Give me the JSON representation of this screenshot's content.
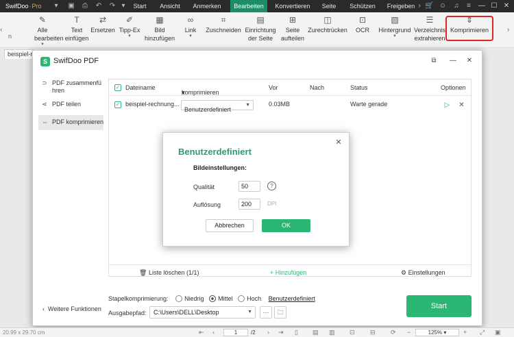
{
  "app": {
    "logo_name": "SwifDoo",
    "logo_pro": "Pro",
    "accent_color": "#2bb673",
    "menu_active_color": "#1e8c67"
  },
  "menu": {
    "tabs": [
      "Start",
      "Ansicht",
      "Anmerken",
      "Bearbeiten",
      "Konvertieren",
      "Seite",
      "Schützen",
      "Freigeben"
    ],
    "active_tab": "Bearbeiten"
  },
  "ribbon": {
    "left_partial": "n",
    "items": [
      {
        "label1": "Alle",
        "label2": "bearbeiten",
        "icon": "edit-icon",
        "caret": true
      },
      {
        "label1": "Text",
        "label2": "einfügen",
        "icon": "text-icon",
        "caret": false
      },
      {
        "label1": "Ersetzen",
        "label2": "",
        "icon": "replace-icon",
        "caret": false
      },
      {
        "label1": "Tipp-Ex",
        "label2": "",
        "icon": "whiteout-icon",
        "caret": true
      },
      {
        "label1": "Bild",
        "label2": "hinzufügen",
        "icon": "image-icon",
        "caret": false
      },
      {
        "label1": "Link",
        "label2": "",
        "icon": "link-icon",
        "caret": true
      },
      {
        "label1": "Zuschneiden",
        "label2": "",
        "icon": "crop-icon",
        "caret": false
      },
      {
        "label1": "Einrichtung",
        "label2": "der Seite",
        "icon": "page-setup-icon",
        "caret": false
      },
      {
        "label1": "Seite",
        "label2": "aufteilen",
        "icon": "split-icon",
        "caret": false
      },
      {
        "label1": "Zurechtrücken",
        "label2": "",
        "icon": "deskew-icon",
        "caret": false
      },
      {
        "label1": "OCR",
        "label2": "",
        "icon": "ocr-icon",
        "caret": false
      },
      {
        "label1": "Hintergrund",
        "label2": "",
        "icon": "background-icon",
        "caret": true
      },
      {
        "label1": "Verzeichnis",
        "label2": "extrahieren",
        "icon": "toc-icon",
        "caret": false
      },
      {
        "label1": "Komprimieren",
        "label2": "",
        "icon": "compress-icon",
        "caret": false
      }
    ],
    "highlighted": "Komprimieren"
  },
  "document": {
    "tab_label": "beispiel-r"
  },
  "statusbar": {
    "dimensions": "20.99 x 29.70 cm",
    "page_current": "1",
    "page_total": "/2",
    "zoom": "125%"
  },
  "dialog": {
    "title": "SwifDoo PDF",
    "nav": [
      {
        "label": "PDF zusammenfü hren",
        "icon": "merge-icon",
        "active": false
      },
      {
        "label": "PDF teilen",
        "icon": "split-icon",
        "active": false
      },
      {
        "label": "PDF komprimieren",
        "icon": "compress-icon",
        "active": true
      }
    ],
    "more_functions": "Weitere Funktionen",
    "table": {
      "headers": {
        "filename": "Dateiname",
        "compress": "komprimieren",
        "before": "Vor",
        "after": "Nach",
        "status": "Status",
        "options": "Optionen"
      },
      "rows": [
        {
          "filename": "beispiel-rechnung...",
          "compress": "Benutzerdefiniert",
          "before": "0.03MB",
          "after": "",
          "status": "Warte gerade"
        }
      ]
    },
    "footer": {
      "clear_list": "Liste löschen (1/1)",
      "add": "Hinzufügen",
      "settings": "Einstellungen"
    },
    "batch": {
      "label": "Stapelkomprimierung:",
      "options": [
        "Niedrig",
        "Mittel",
        "Hoch"
      ],
      "selected": "Mittel",
      "custom_link": "Benutzerdefiniert"
    },
    "output": {
      "label": "Ausgabepfad:",
      "path": "C:\\Users\\DELL\\Desktop",
      "more": "···"
    },
    "start_button": "Start"
  },
  "custom_dialog": {
    "title": "Benutzerdefiniert",
    "section": "Bildeinstellungen:",
    "quality_label": "Qualität",
    "quality_value": "50",
    "resolution_label": "Auflösung",
    "resolution_value": "200",
    "resolution_unit": "DPI",
    "cancel": "Abbrechen",
    "ok": "OK"
  }
}
